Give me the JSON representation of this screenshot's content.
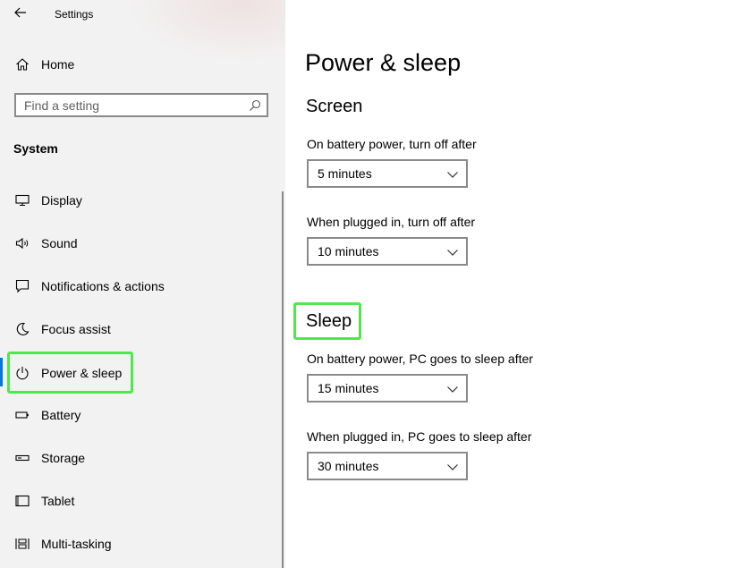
{
  "app": {
    "title": "Settings"
  },
  "sidebar": {
    "home_label": "Home",
    "search": {
      "placeholder": "Find a setting",
      "value": ""
    },
    "section_label": "System",
    "items": [
      {
        "label": "Display",
        "icon": "monitor-icon"
      },
      {
        "label": "Sound",
        "icon": "speaker-icon"
      },
      {
        "label": "Notifications & actions",
        "icon": "message-icon"
      },
      {
        "label": "Focus assist",
        "icon": "moon-icon"
      },
      {
        "label": "Power & sleep",
        "icon": "power-icon",
        "selected": true
      },
      {
        "label": "Battery",
        "icon": "battery-icon"
      },
      {
        "label": "Storage",
        "icon": "storage-icon"
      },
      {
        "label": "Tablet",
        "icon": "tablet-icon"
      },
      {
        "label": "Multi-tasking",
        "icon": "multitasking-icon"
      }
    ]
  },
  "main": {
    "title": "Power & sleep",
    "screen": {
      "heading": "Screen",
      "battery_label": "On battery power, turn off after",
      "battery_value": "5 minutes",
      "plugged_label": "When plugged in, turn off after",
      "plugged_value": "10 minutes"
    },
    "sleep": {
      "heading": "Sleep",
      "battery_label": "On battery power, PC goes to sleep after",
      "battery_value": "15 minutes",
      "plugged_label": "When plugged in, PC goes to sleep after",
      "plugged_value": "30 minutes"
    }
  },
  "colors": {
    "highlight": "#4de94c",
    "accent": "#0078d7",
    "sidebar_bg": "#f2f2f2"
  }
}
